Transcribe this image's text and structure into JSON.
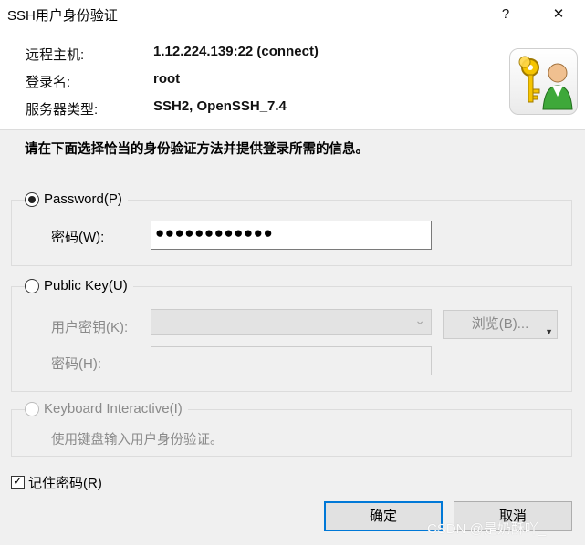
{
  "window": {
    "title": "SSH用户身份验证",
    "help_label": "?",
    "close_label": "✕"
  },
  "header": {
    "host_label": "远程主机:",
    "host_value": "1.12.224.139:22 (connect)",
    "login_label": "登录名:",
    "login_value": "root",
    "server_label": "服务器类型:",
    "server_value": "SSH2, OpenSSH_7.4"
  },
  "instruction": "请在下面选择恰当的身份验证方法并提供登录所需的信息。",
  "password_group": {
    "label": "Password(P)",
    "selected": true,
    "field_label": "密码(W):",
    "value_masked": "●●●●●●●●●●●●"
  },
  "pubkey_group": {
    "label": "Public Key(U)",
    "selected": false,
    "key_label": "用户密钥(K):",
    "browse_label": "浏览(B)...",
    "pass_label": "密码(H):"
  },
  "keyboard_group": {
    "label": "Keyboard Interactive(I)",
    "selected": false,
    "description": "使用键盘输入用户身份验证。"
  },
  "remember": {
    "label": "记住密码(R)",
    "checked": true,
    "check_glyph": "✓"
  },
  "buttons": {
    "ok": "确定",
    "cancel": "取消"
  },
  "watermark": "CSDN @是奶酥吖_",
  "colors": {
    "accent": "#0078d7",
    "panel": "#f0f0f0"
  }
}
